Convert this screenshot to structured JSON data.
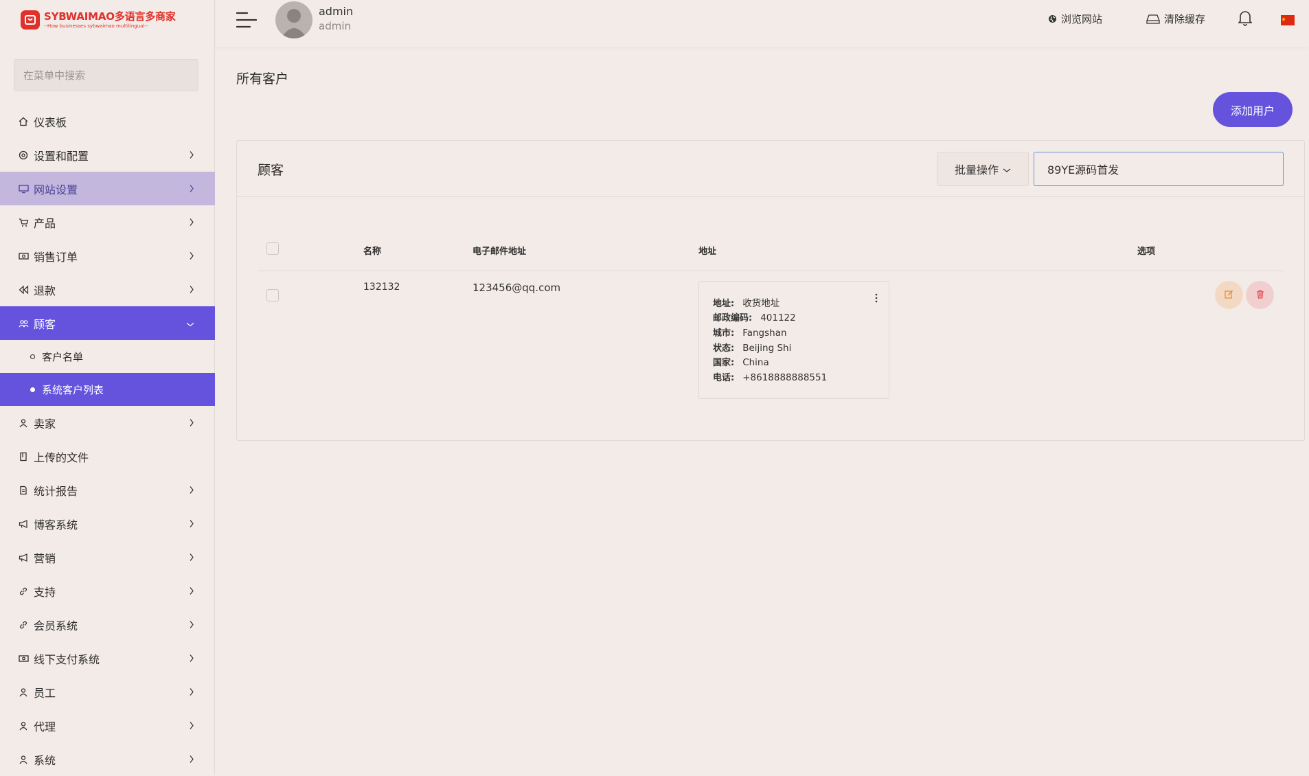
{
  "brand": {
    "title": "SYBWAIMAO多语言多商家",
    "subtitle": "--How businesses sybwaimao multilingual--",
    "color": "#e0312b"
  },
  "sidebar": {
    "search_placeholder": "在菜单中搜索",
    "items": [
      {
        "label": "仪表板",
        "icon": "home-icon"
      },
      {
        "label": "设置和配置",
        "icon": "settings-icon"
      },
      {
        "label": "网站设置",
        "icon": "monitor-icon"
      },
      {
        "label": "产品",
        "icon": "cart-icon"
      },
      {
        "label": "销售订单",
        "icon": "money-icon"
      },
      {
        "label": "退款",
        "icon": "rewind-icon"
      },
      {
        "label": "顾客",
        "icon": "users-icon"
      },
      {
        "label": "卖家",
        "icon": "user-icon"
      },
      {
        "label": "上传的文件",
        "icon": "folder-icon"
      },
      {
        "label": "统计报告",
        "icon": "file-icon"
      },
      {
        "label": "博客系统",
        "icon": "megaphone-icon"
      },
      {
        "label": "营销",
        "icon": "megaphone-icon"
      },
      {
        "label": "支持",
        "icon": "link-icon"
      },
      {
        "label": "会员系统",
        "icon": "link-icon"
      },
      {
        "label": "线下支付系统",
        "icon": "money-icon"
      },
      {
        "label": "员工",
        "icon": "user-icon"
      },
      {
        "label": "代理",
        "icon": "user-icon"
      },
      {
        "label": "系统",
        "icon": "user-icon"
      }
    ],
    "customer_submenu": [
      {
        "label": "客户名单"
      },
      {
        "label": "系统客户列表"
      }
    ],
    "accent": "#6653dd",
    "highlight": "#c3b7de"
  },
  "topbar": {
    "user_name": "admin",
    "user_role": "admin",
    "browse_site": "浏览网站",
    "clear_cache": "清除缓存"
  },
  "main": {
    "page_title": "所有客户",
    "add_button": "添加用户",
    "card_title": "顾客",
    "bulk_action": "批量操作",
    "search_value": "89YE源码首发",
    "columns": [
      "名称",
      "电子邮件地址",
      "地址",
      "选项"
    ],
    "rows": [
      {
        "name": "132132",
        "email": "123456@qq.com",
        "address": {
          "address_label": "地址:",
          "address_value": "收货地址",
          "postal_label": "邮政编码:",
          "postal_value": "401122",
          "city_label": "城市:",
          "city_value": "Fangshan",
          "state_label": "状态:",
          "state_value": "Beijing Shi",
          "country_label": "国家:",
          "country_value": "China",
          "phone_label": "电话:",
          "phone_value": "+8618888888551"
        }
      }
    ]
  }
}
